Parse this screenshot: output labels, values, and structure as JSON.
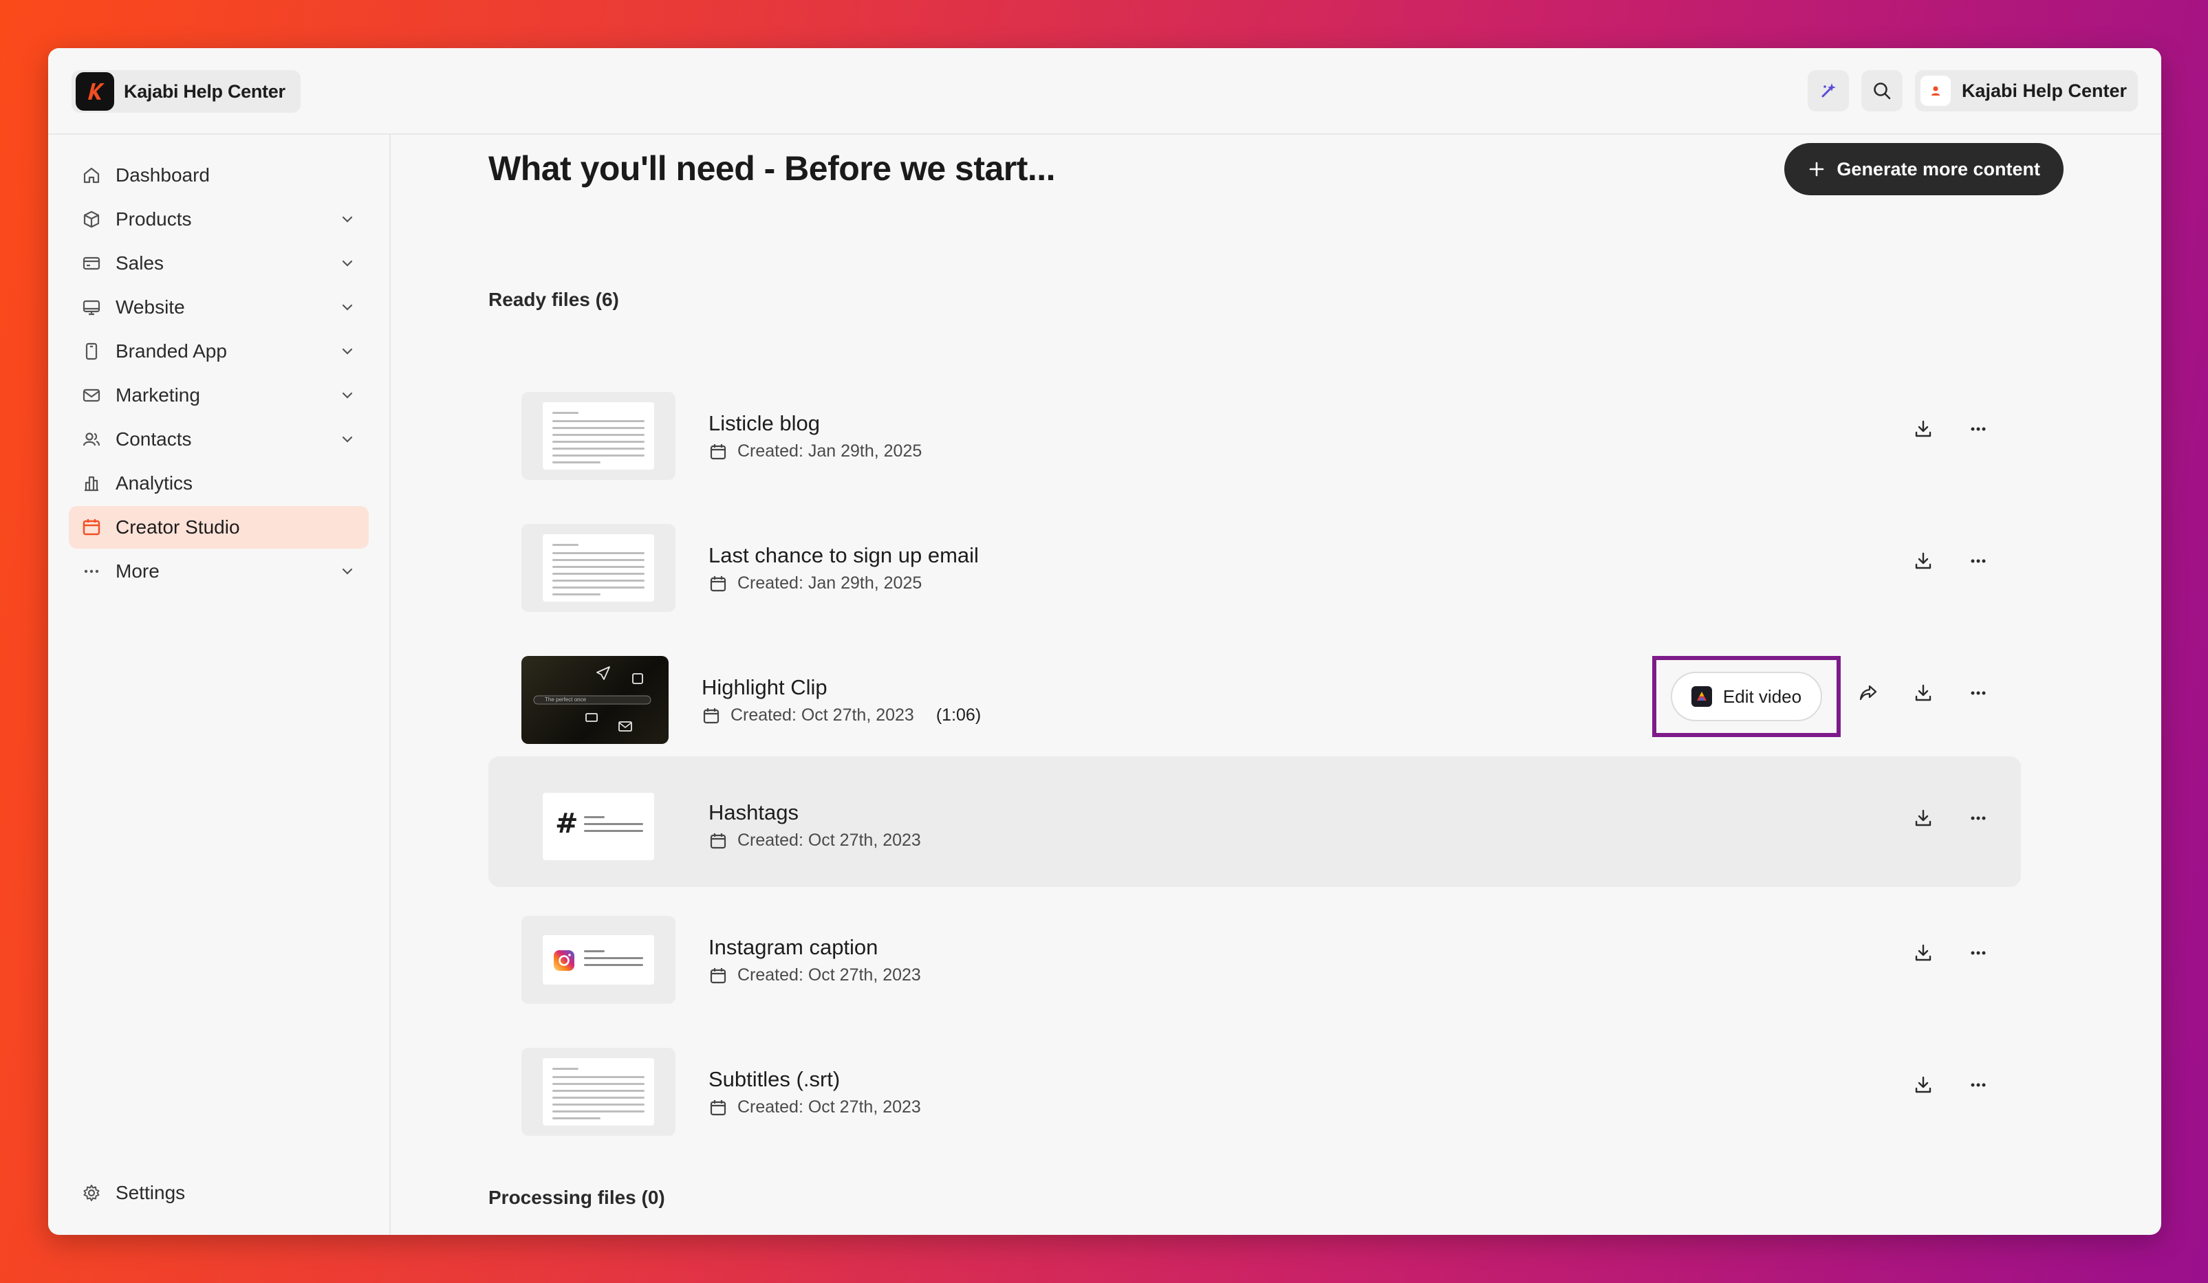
{
  "header": {
    "brand_name": "Kajabi Help Center",
    "account_name": "Kajabi Help Center"
  },
  "sidebar": {
    "items": [
      {
        "label": "Dashboard",
        "icon": "home-icon",
        "expandable": false
      },
      {
        "label": "Products",
        "icon": "box-icon",
        "expandable": true
      },
      {
        "label": "Sales",
        "icon": "credit-card-icon",
        "expandable": true
      },
      {
        "label": "Website",
        "icon": "monitor-icon",
        "expandable": true
      },
      {
        "label": "Branded App",
        "icon": "phone-icon",
        "expandable": true
      },
      {
        "label": "Marketing",
        "icon": "mail-icon",
        "expandable": true
      },
      {
        "label": "Contacts",
        "icon": "contacts-icon",
        "expandable": true
      },
      {
        "label": "Analytics",
        "icon": "bar-chart-icon",
        "expandable": false
      },
      {
        "label": "Creator Studio",
        "icon": "calendar-icon",
        "expandable": false,
        "active": true
      },
      {
        "label": "More",
        "icon": "ellipsis-icon",
        "expandable": true
      }
    ],
    "settings_label": "Settings"
  },
  "main": {
    "title": "What you'll need - Before we start...",
    "generate_label": "Generate more content",
    "ready_label": "Ready files (6)",
    "processing_label": "Processing files (0)",
    "edit_video_label": "Edit video",
    "files": [
      {
        "name": "Listicle blog",
        "created": "Created: Jan 29th, 2025",
        "thumb": "document"
      },
      {
        "name": "Last chance to sign up email",
        "created": "Created: Jan 29th, 2025",
        "thumb": "document"
      },
      {
        "name": "Highlight Clip",
        "created": "Created: Oct 27th, 2023",
        "duration": "(1:06)",
        "thumb": "video",
        "video_search_text": "The perfect once"
      },
      {
        "name": "Hashtags",
        "created": "Created: Oct 27th, 2023",
        "thumb": "hashtag"
      },
      {
        "name": "Instagram caption",
        "created": "Created: Oct 27th, 2023",
        "thumb": "instagram"
      },
      {
        "name": "Subtitles (.srt)",
        "created": "Created: Oct 27th, 2023",
        "thumb": "document"
      }
    ]
  },
  "colors": {
    "accent": "#f04e23",
    "active_bg": "#fde2d8",
    "highlight_border": "#7e1b8a",
    "dark_button": "#2a2a2a"
  }
}
